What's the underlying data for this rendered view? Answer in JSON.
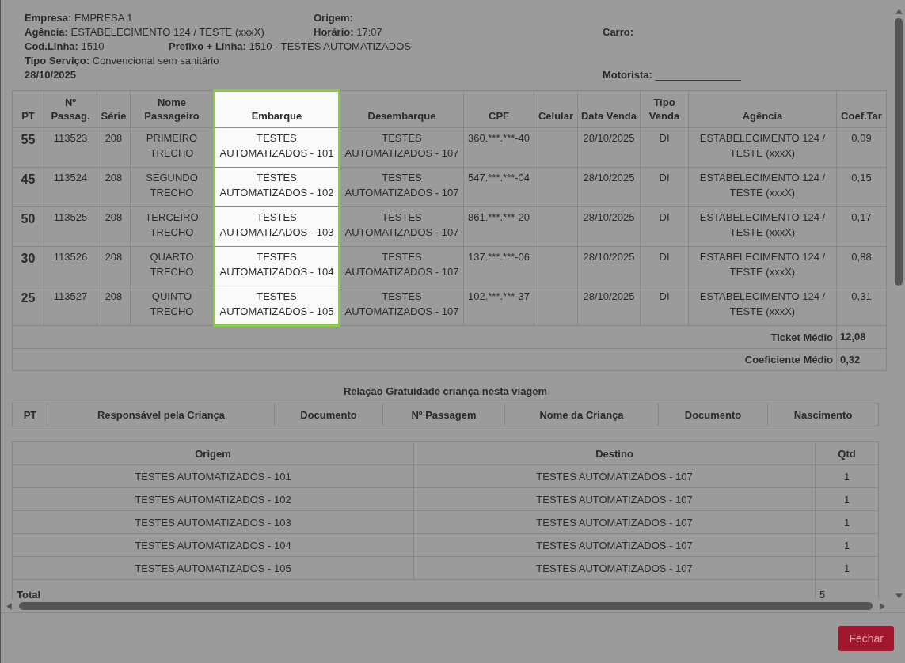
{
  "header": {
    "fields": [
      {
        "label": "Empresa:",
        "value": "EMPRESA 1"
      },
      {
        "label": "Origem:"
      },
      {
        "label": "Agência:",
        "value": "ESTABELECIMENTO 124 / TESTE (xxxX)"
      },
      {
        "label": "Horário:",
        "value": "17:07"
      },
      {
        "label": "Carro:"
      },
      {
        "label": "Cod.Linha:",
        "value": "1510"
      },
      {
        "label": "Prefixo + Linha:",
        "value": "1510 - TESTES AUTOMATIZADOS"
      },
      {
        "label": "Tipo Serviço:",
        "value": "Convencional sem sanitário"
      },
      {
        "value": "28/10/2025"
      },
      {
        "label": "Motorista:",
        "value": "_______________"
      }
    ]
  },
  "passengers": {
    "columns": [
      {
        "label": "PT",
        "highlighted": false
      },
      {
        "label": "Nº Passag.",
        "highlighted": false
      },
      {
        "label": "Série",
        "highlighted": false
      },
      {
        "label": "Nome Passageiro",
        "highlighted": false
      },
      {
        "label": "Embarque",
        "highlighted": true
      },
      {
        "label": "Desembarque",
        "highlighted": false
      },
      {
        "label": "CPF",
        "highlighted": false
      },
      {
        "label": "Celular",
        "highlighted": false
      },
      {
        "label": "Data Venda",
        "highlighted": false
      },
      {
        "label": "Tipo Venda",
        "highlighted": false
      },
      {
        "label": "Agência",
        "highlighted": false
      },
      {
        "label": "Coef.Tar",
        "highlighted": false
      }
    ],
    "rows": [
      [
        "55",
        "113523",
        "208",
        "PRIMEIRO TRECHO",
        "TESTES AUTOMATIZADOS - 101",
        "TESTES AUTOMATIZADOS - 107",
        "360.***.***-40",
        "",
        "28/10/2025",
        "DI",
        "ESTABELECIMENTO 124 / TESTE (xxxX)",
        "0,09"
      ],
      [
        "45",
        "113524",
        "208",
        "SEGUNDO TRECHO",
        "TESTES AUTOMATIZADOS - 102",
        "TESTES AUTOMATIZADOS - 107",
        "547.***.***-04",
        "",
        "28/10/2025",
        "DI",
        "ESTABELECIMENTO 124 / TESTE (xxxX)",
        "0,15"
      ],
      [
        "50",
        "113525",
        "208",
        "TERCEIRO TRECHO",
        "TESTES AUTOMATIZADOS - 103",
        "TESTES AUTOMATIZADOS - 107",
        "861.***.***-20",
        "",
        "28/10/2025",
        "DI",
        "ESTABELECIMENTO 124 / TESTE (xxxX)",
        "0,17"
      ],
      [
        "30",
        "113526",
        "208",
        "QUARTO TRECHO",
        "TESTES AUTOMATIZADOS - 104",
        "TESTES AUTOMATIZADOS - 107",
        "137.***.***-06",
        "",
        "28/10/2025",
        "DI",
        "ESTABELECIMENTO 124 / TESTE (xxxX)",
        "0,88"
      ],
      [
        "25",
        "113527",
        "208",
        "QUINTO TRECHO",
        "TESTES AUTOMATIZADOS - 105",
        "TESTES AUTOMATIZADOS - 107",
        "102.***.***-37",
        "",
        "28/10/2025",
        "DI",
        "ESTABELECIMENTO 124 / TESTE (xxxX)",
        "0,31"
      ]
    ],
    "summary": [
      {
        "label": "Ticket Médio",
        "value": "12,08"
      },
      {
        "label": "Coeficiente Médio",
        "value": "0,32"
      }
    ]
  },
  "children": {
    "title": "Relação Gratuidade criança nesta viagem",
    "columns": [
      "PT",
      "Responsável pela Criança",
      "Documento",
      "Nº Passagem",
      "Nome da Criança",
      "Documento",
      "Nascimento"
    ]
  },
  "segments": {
    "columns": [
      "Origem",
      "Destino",
      "Qtd"
    ],
    "rows": [
      [
        "TESTES AUTOMATIZADOS - 101",
        "TESTES AUTOMATIZADOS - 107",
        "1"
      ],
      [
        "TESTES AUTOMATIZADOS - 102",
        "TESTES AUTOMATIZADOS - 107",
        "1"
      ],
      [
        "TESTES AUTOMATIZADOS - 103",
        "TESTES AUTOMATIZADOS - 107",
        "1"
      ],
      [
        "TESTES AUTOMATIZADOS - 104",
        "TESTES AUTOMATIZADOS - 107",
        "1"
      ],
      [
        "TESTES AUTOMATIZADOS - 105",
        "TESTES AUTOMATIZADOS - 107",
        "1"
      ]
    ],
    "total": {
      "label": "Total",
      "value": "5"
    }
  },
  "buttons": [
    "Fechar"
  ]
}
